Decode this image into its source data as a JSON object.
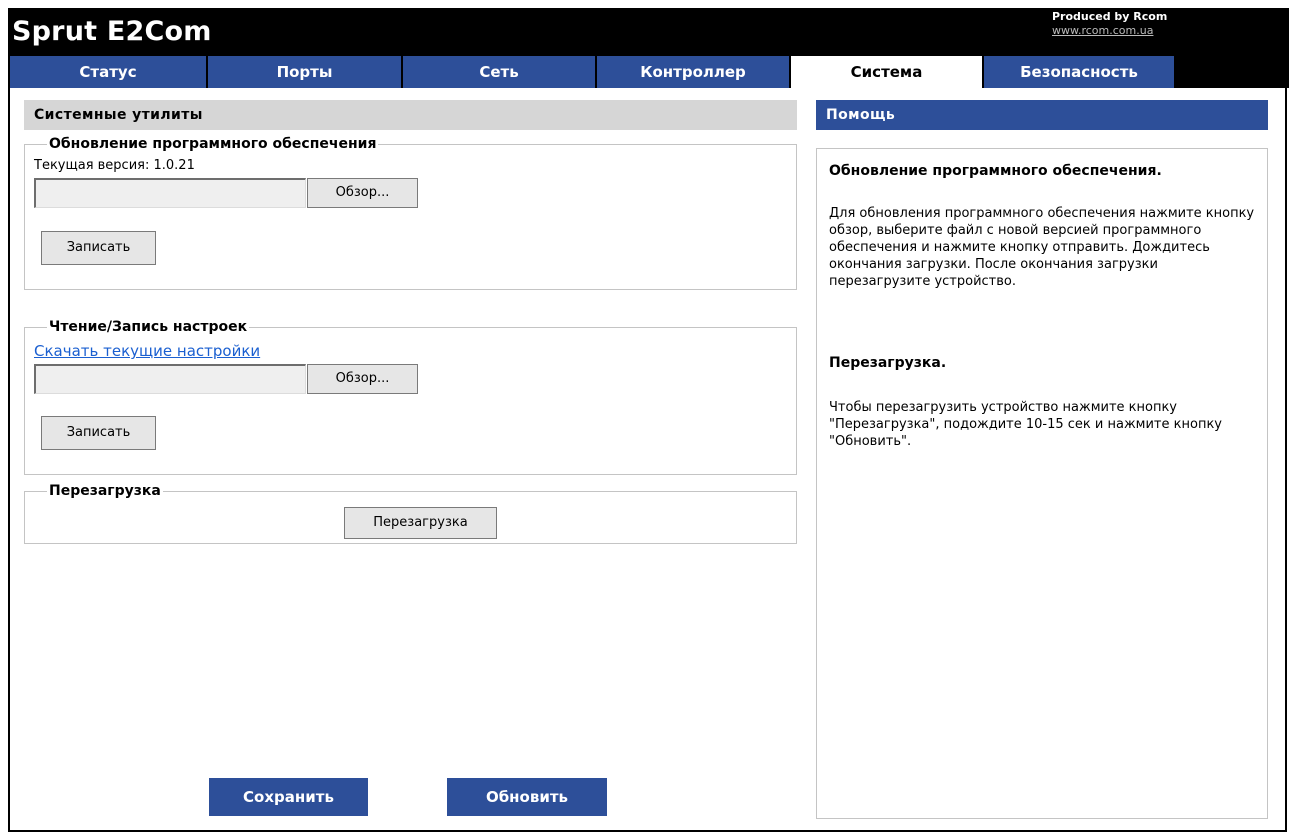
{
  "header": {
    "brand": "Sprut E2Com",
    "produced_by": "Produced by Rcom",
    "website": "www.rcom.com.ua"
  },
  "tabs": [
    {
      "label": "Статус"
    },
    {
      "label": "Порты"
    },
    {
      "label": "Сеть"
    },
    {
      "label": "Контроллер"
    },
    {
      "label": "Система",
      "active": true
    },
    {
      "label": "Безопасность"
    }
  ],
  "left_panel": {
    "title": "Системные утилиты",
    "firmware": {
      "legend": "Обновление программного обеспечения",
      "current_version": "Текущая версия: 1.0.21",
      "browse_label": "Обзор...",
      "write_label": "Записать"
    },
    "settings": {
      "legend": "Чтение/Запись настроек",
      "download_link": "Скачать текущие настройки",
      "browse_label": "Обзор...",
      "write_label": "Записать"
    },
    "reboot": {
      "legend": "Перезагрузка",
      "button_label": "Перезагрузка"
    }
  },
  "help_panel": {
    "title": "Помощь",
    "sections": [
      {
        "heading": "Обновление программного обеспечения.",
        "text": "Для обновления программного обеспечения нажмите кнопку обзор, выберите файл с новой версией программного обеспечения и нажмите кнопку отправить. Дождитесь окончания загрузки. После окончания загрузки перезагрузите устройство."
      },
      {
        "heading": "Перезагрузка.",
        "text": "Чтобы перезагрузить устройство нажмите кнопку \"Перезагрузка\", подождите 10-15 сек и нажмите кнопку \"Обновить\"."
      }
    ]
  },
  "footer": {
    "save_label": "Сохранить",
    "refresh_label": "Обновить"
  },
  "colors": {
    "tab_blue": "#2d4f99",
    "header_black": "#000000",
    "section_gray": "#d6d6d6",
    "link_blue": "#1a5fd0"
  }
}
